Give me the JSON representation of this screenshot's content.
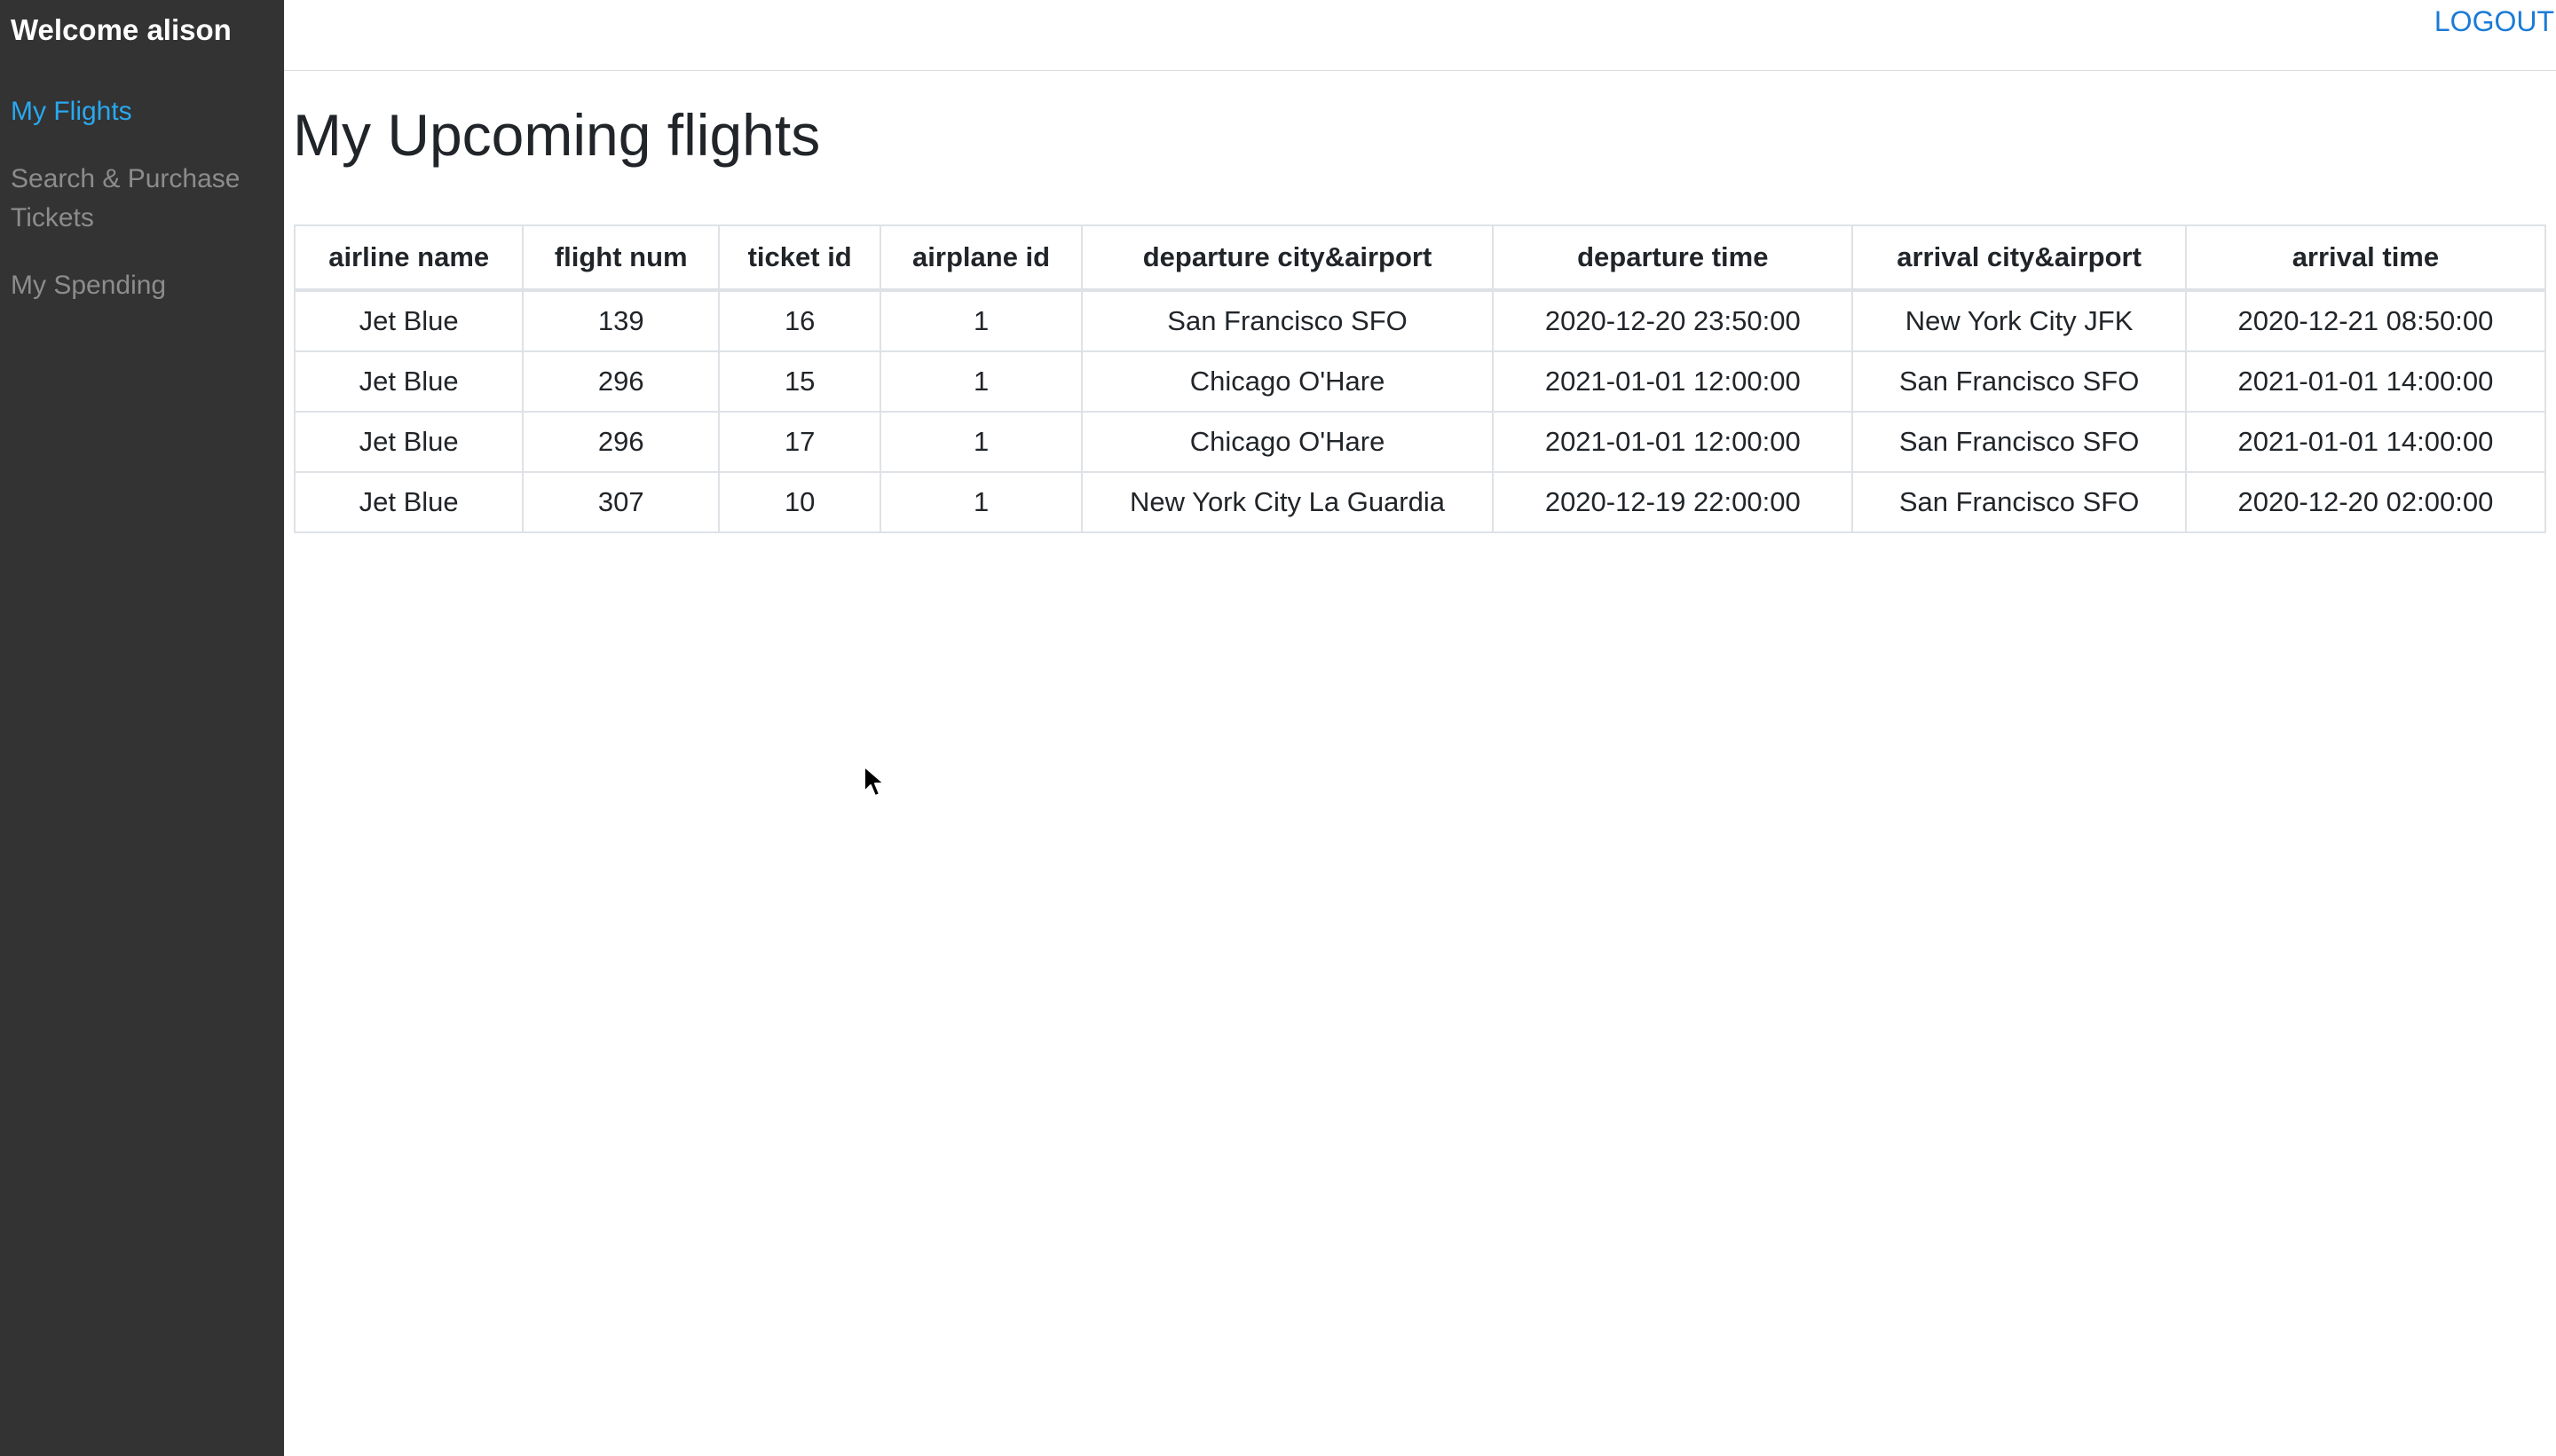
{
  "sidebar": {
    "welcome": "Welcome alison",
    "items": [
      {
        "label": "My Flights",
        "active": true
      },
      {
        "label": "Search & Purchase Tickets",
        "active": false
      },
      {
        "label": "My Spending",
        "active": false
      }
    ]
  },
  "header": {
    "logout_label": "LOGOUT"
  },
  "main": {
    "title": "My Upcoming flights",
    "table": {
      "columns": [
        "airline name",
        "flight num",
        "ticket id",
        "airplane id",
        "departure city&airport",
        "departure time",
        "arrival city&airport",
        "arrival time"
      ],
      "rows": [
        [
          "Jet Blue",
          "139",
          "16",
          "1",
          "San Francisco SFO",
          "2020-12-20 23:50:00",
          "New York City JFK",
          "2020-12-21 08:50:00"
        ],
        [
          "Jet Blue",
          "296",
          "15",
          "1",
          "Chicago O'Hare",
          "2021-01-01 12:00:00",
          "San Francisco SFO",
          "2021-01-01 14:00:00"
        ],
        [
          "Jet Blue",
          "296",
          "17",
          "1",
          "Chicago O'Hare",
          "2021-01-01 12:00:00",
          "San Francisco SFO",
          "2021-01-01 14:00:00"
        ],
        [
          "Jet Blue",
          "307",
          "10",
          "1",
          "New York City La Guardia",
          "2020-12-19 22:00:00",
          "San Francisco SFO",
          "2020-12-20 02:00:00"
        ]
      ]
    }
  },
  "colors": {
    "sidebar_bg": "#333333",
    "active_link": "#29a8f0",
    "inactive_link": "#8c8c8c",
    "logout_link": "#1a7bd6"
  },
  "icons": {
    "cursor": "mouse-pointer-icon"
  }
}
